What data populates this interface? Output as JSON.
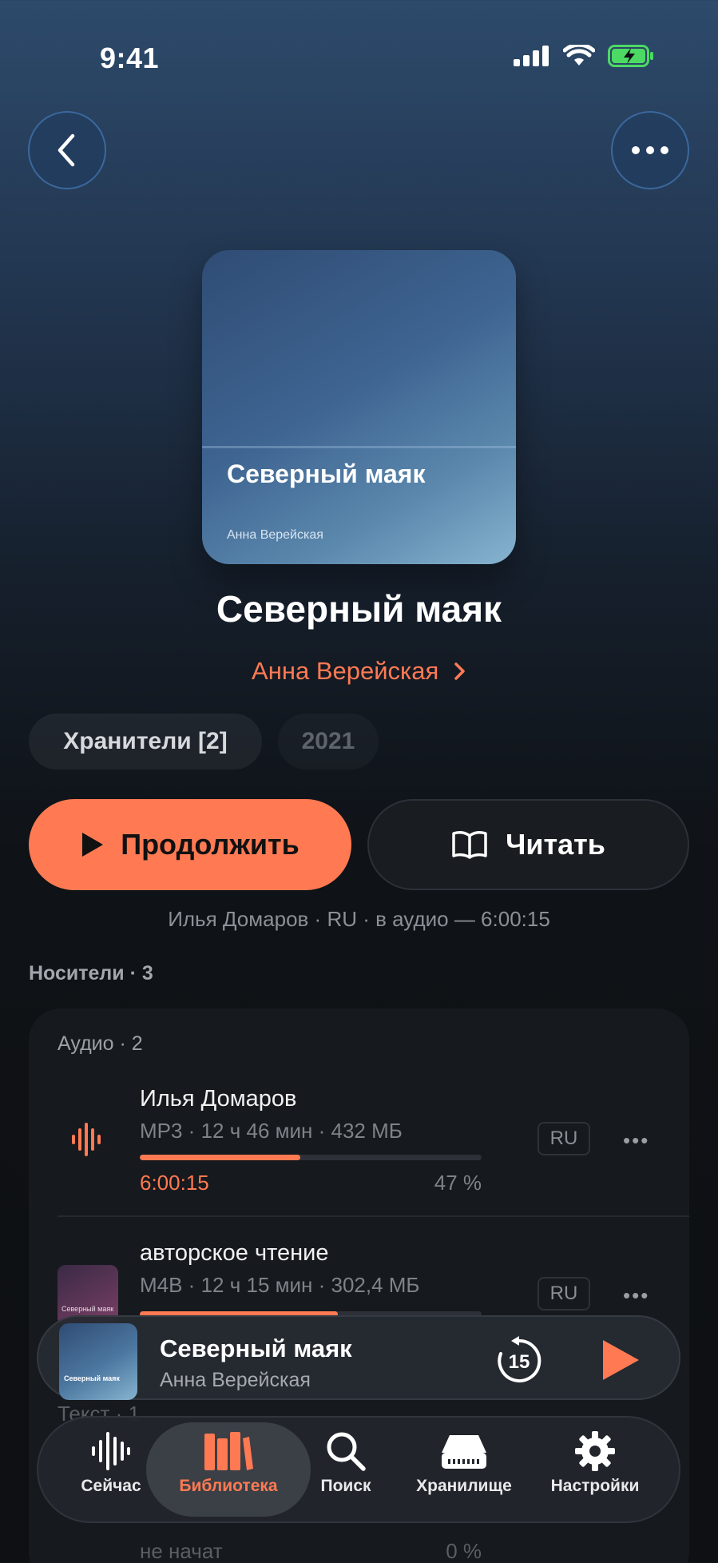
{
  "status_bar": {
    "time": "9:41"
  },
  "book": {
    "cover_title": "Северный маяк",
    "cover_author": "Анна Верейская",
    "title": "Северный маяк",
    "author": "Анна Верейская",
    "series_chip": "Хранители [2]",
    "year_chip": "2021"
  },
  "actions": {
    "continue_label": "Продолжить",
    "read_label": "Читать"
  },
  "meta_line": "Илья Домаров · RU · в аудио — 6:00:15",
  "media": {
    "section_title": "Носители · 3",
    "audio_title": "Аудио · 2",
    "tracks": [
      {
        "name": "Илья Домаров",
        "meta": "MP3 · 12 ч 46 мин · 432 МБ",
        "lang": "RU",
        "position": "6:00:15",
        "percent": "47 %",
        "progress": 0.47,
        "more": "•••"
      },
      {
        "name": "авторское чтение",
        "meta": "M4B · 12 ч 15 мин · 302,4 МБ",
        "lang": "RU",
        "more": "•••",
        "progress": 0.58,
        "cover_text": "Северный маяк"
      }
    ],
    "text_section_partial": "Текст · 1",
    "text_status": "не начат",
    "text_percent": "0 %"
  },
  "mini_player": {
    "title": "Северный маяк",
    "author": "Анна Верейская",
    "skip_seconds": "15",
    "cover_text": "Северный маяк"
  },
  "tabs": [
    {
      "label": "Сейчас",
      "icon": "waveform-icon"
    },
    {
      "label": "Библиотека",
      "icon": "books-icon",
      "active": true
    },
    {
      "label": "Поиск",
      "icon": "search-icon"
    },
    {
      "label": "Хранилище",
      "icon": "storage-icon"
    },
    {
      "label": "Настройки",
      "icon": "gear-icon"
    }
  ],
  "colors": {
    "accent": "#ff7a53",
    "background": "#0e1013"
  }
}
